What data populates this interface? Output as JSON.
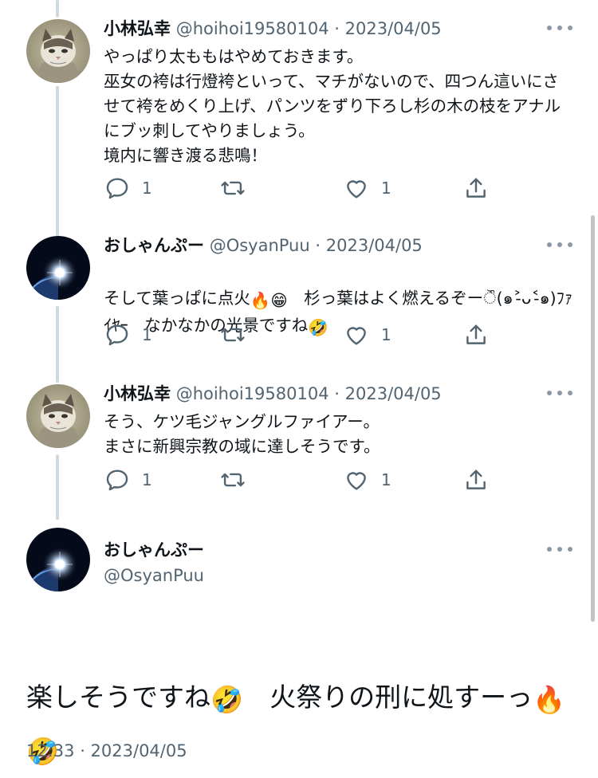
{
  "tweets": [
    {
      "name": "小林弘幸",
      "handle": "@hoihoi19580104",
      "sep": "·",
      "date": "2023/04/05",
      "text": "やっぱり太ももはやめておきます。\n巫女の袴は行燈袴といって、マチがないので、四つん這いにさせて袴をめくり上げ、パンツをずり下ろし杉の木の枝をアナルにブッ刺してやりましょう。\n境内に響き渡る悲鳴！",
      "reply_count": "1",
      "like_count": "1",
      "avatar": "cat-avatar"
    },
    {
      "name": "おしゃんぷー",
      "handle": "@OsyanPuu",
      "sep": "·",
      "date": "2023/04/05",
      "text_a": "そして葉っぱに点火",
      "emoji_fire": "🔥",
      "emoji_grin": "😁",
      "text_b": "　杉っ葉はよく燃えるぞーੌ(๑˃̵ᴗ˂̵๑)ﾌｧｲﾔｰ　なかなかの光景ですね",
      "emoji_rofl": "🤣",
      "reply_count": "1",
      "like_count": "1",
      "avatar": "eclipse-avatar"
    },
    {
      "name": "小林弘幸",
      "handle": "@hoihoi19580104",
      "sep": "·",
      "date": "2023/04/05",
      "text": "そう、ケツ毛ジャングルファイアー。\nまさに新興宗教の域に達しそうです。",
      "reply_count": "1",
      "like_count": "1",
      "avatar": "cat-avatar"
    }
  ],
  "main_tweet": {
    "name": "おしゃんぷー",
    "handle": "@OsyanPuu",
    "text_a": "楽しそうですね",
    "emoji_rofl": "🤣",
    "text_b": "　火祭りの刑に処すーっ",
    "emoji_fire": "🔥",
    "emoji_rofl2": "🤣",
    "timestamp": "12:33 · 2023/04/05"
  },
  "icons": [
    "reply-icon",
    "retweet-icon",
    "like-icon",
    "share-icon",
    "more-icon"
  ],
  "colors": {
    "secondary": "#536471",
    "thread_line": "#cfd9de",
    "text": "#0f1419"
  }
}
